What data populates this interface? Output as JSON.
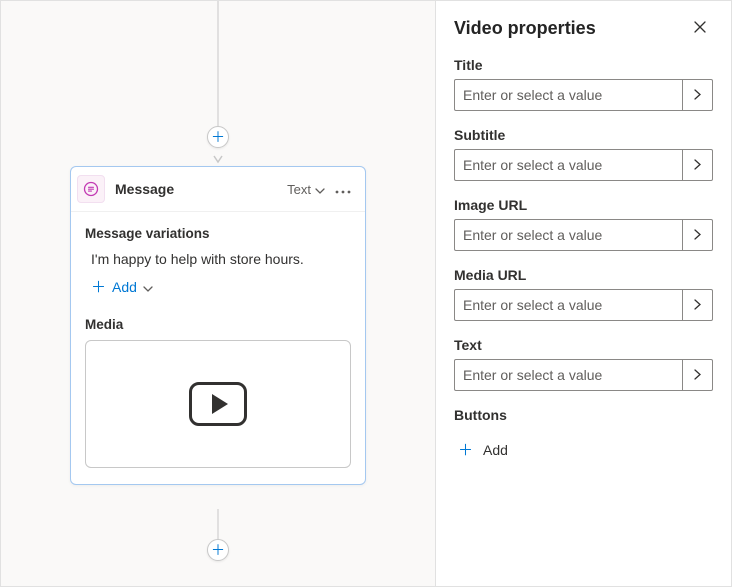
{
  "canvas": {
    "node": {
      "title": "Message",
      "type_label": "Text",
      "variations_label": "Message variations",
      "variation_text": "I'm happy to help with store hours.",
      "add_label": "Add",
      "media_label": "Media"
    }
  },
  "panel": {
    "title": "Video properties",
    "placeholder": "Enter or select a value",
    "fields": {
      "title": {
        "label": "Title",
        "value": ""
      },
      "subtitle": {
        "label": "Subtitle",
        "value": ""
      },
      "image_url": {
        "label": "Image URL",
        "value": ""
      },
      "media_url": {
        "label": "Media URL",
        "value": ""
      },
      "text": {
        "label": "Text",
        "value": ""
      }
    },
    "buttons_label": "Buttons",
    "add_label": "Add"
  }
}
